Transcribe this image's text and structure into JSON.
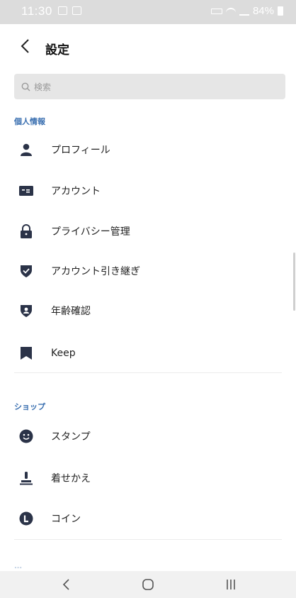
{
  "status_bar": {
    "time": "11:30",
    "battery": "84%"
  },
  "header": {
    "title": "設定"
  },
  "search": {
    "placeholder": "検索"
  },
  "sections": [
    {
      "title": "個人情報",
      "items": [
        {
          "label": "プロフィール",
          "icon": "person-icon"
        },
        {
          "label": "アカウント",
          "icon": "id-card-icon"
        },
        {
          "label": "プライバシー管理",
          "icon": "lock-icon"
        },
        {
          "label": "アカウント引き継ぎ",
          "icon": "shield-check-icon"
        },
        {
          "label": "年齢確認",
          "icon": "shield-person-icon"
        },
        {
          "label": "Keep",
          "icon": "bookmark-icon"
        }
      ]
    },
    {
      "title": "ショップ",
      "items": [
        {
          "label": "スタンプ",
          "icon": "smiley-icon"
        },
        {
          "label": "着せかえ",
          "icon": "stamp-icon"
        },
        {
          "label": "コイン",
          "icon": "coin-icon"
        }
      ]
    }
  ],
  "colors": {
    "section_title": "#3a6fb0",
    "icon": "#2b3348",
    "status_bar": "#dcdcdc"
  }
}
